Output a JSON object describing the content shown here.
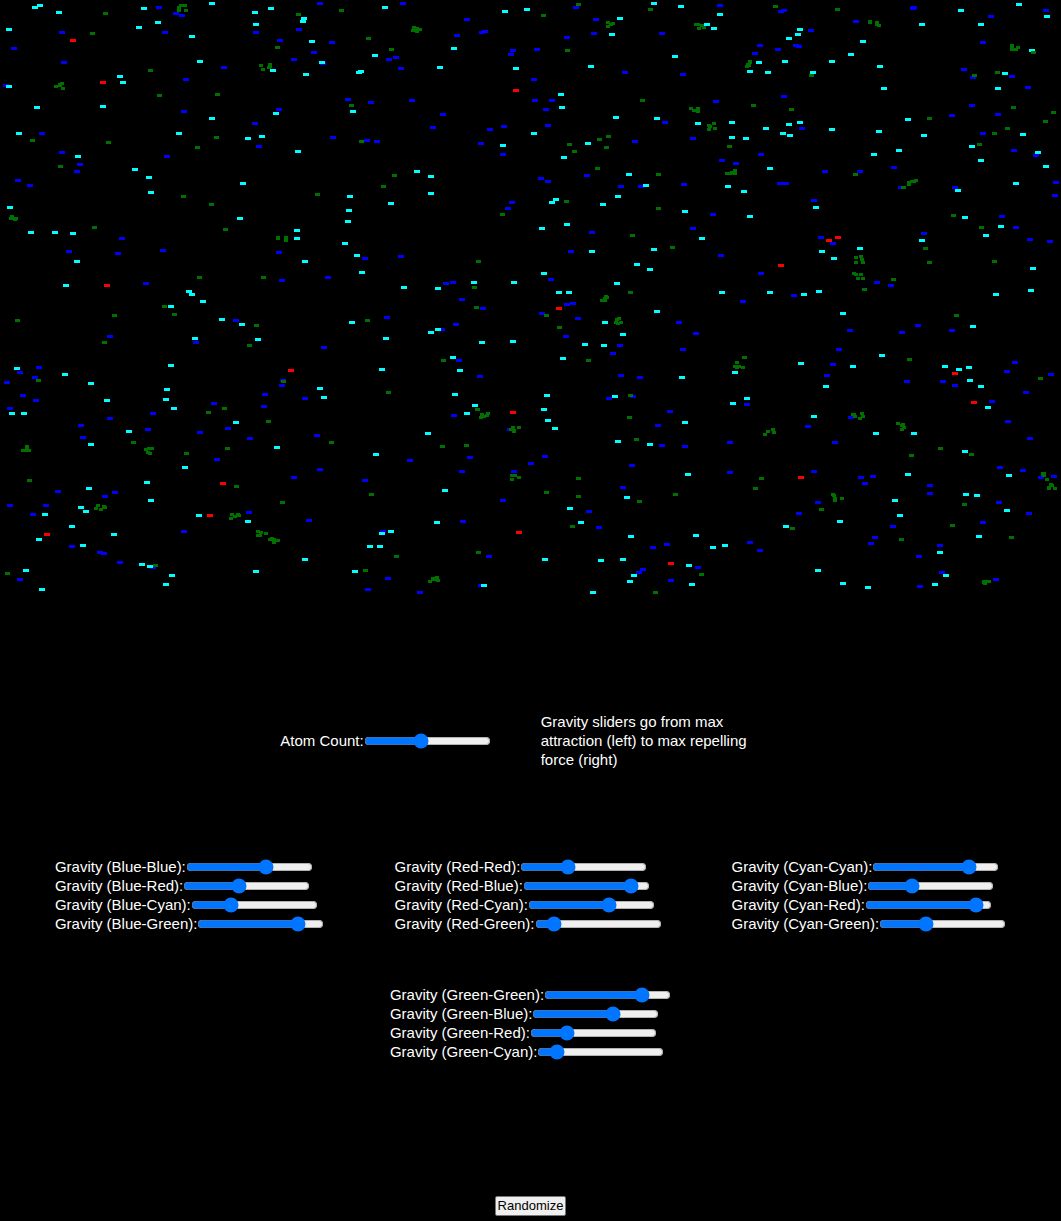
{
  "atoms": [
    {
      "color": "#0000ff"
    },
    {
      "color": "#ff0000"
    },
    {
      "color": "#00ffff"
    },
    {
      "color": "#007000"
    }
  ],
  "atom_count": {
    "label": "Atom Count:",
    "level": 0.44
  },
  "note": "Gravity sliders go from max attraction (left) to max repelling force (right)",
  "gravity_groups": [
    {
      "sliders": [
        {
          "label": "Gravity (Blue-Blue):",
          "level": 0.65
        },
        {
          "label": "Gravity (Blue-Red):",
          "level": 0.43
        },
        {
          "label": "Gravity (Blue-Cyan):",
          "level": 0.29
        },
        {
          "label": "Gravity (Blue-Green):",
          "level": 0.83
        }
      ]
    },
    {
      "sliders": [
        {
          "label": "Gravity (Red-Red):",
          "level": 0.36
        },
        {
          "label": "Gravity (Red-Blue):",
          "level": 0.9
        },
        {
          "label": "Gravity (Red-Cyan):",
          "level": 0.66
        },
        {
          "label": "Gravity (Red-Green):",
          "level": 0.1
        }
      ]
    },
    {
      "sliders": [
        {
          "label": "Gravity (Cyan-Cyan):",
          "level": 0.8
        },
        {
          "label": "Gravity (Cyan-Blue):",
          "level": 0.33
        },
        {
          "label": "Gravity (Cyan-Red):",
          "level": 0.93
        },
        {
          "label": "Gravity (Cyan-Green):",
          "level": 0.35
        }
      ]
    },
    {
      "sliders": [
        {
          "label": "Gravity (Green-Green):",
          "level": 0.81
        },
        {
          "label": "Gravity (Green-Blue):",
          "level": 0.65
        },
        {
          "label": "Gravity (Green-Red):",
          "level": 0.26
        },
        {
          "label": "Gravity (Green-Cyan):",
          "level": 0.1
        }
      ]
    }
  ],
  "buttons": [
    "Randomize"
  ]
}
